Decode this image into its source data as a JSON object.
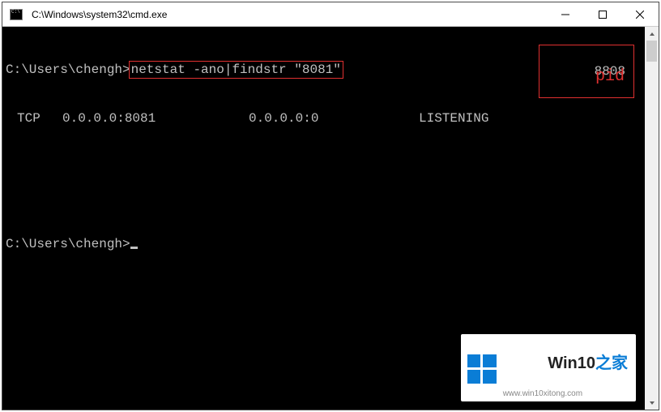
{
  "titlebar": {
    "title": "C:\\Windows\\system32\\cmd.exe"
  },
  "terminal": {
    "prompt1": "C:\\Users\\chengh>",
    "command": "netstat -ano|findstr \"8081\"",
    "result": {
      "proto": "TCP",
      "local": "0.0.0.0:8081",
      "foreign": "0.0.0.0:0",
      "state": "LISTENING",
      "pid": "8808"
    },
    "prompt2": "C:\\Users\\chengh>"
  },
  "annotations": {
    "pid_label": "pid"
  },
  "watermark": {
    "title_a": "Win10",
    "title_b": "之家",
    "url": "www.win10xitong.com"
  }
}
